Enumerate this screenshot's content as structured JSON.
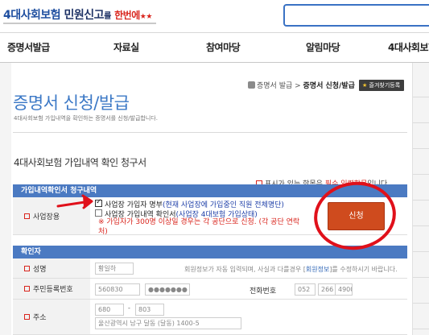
{
  "header": {
    "logo": {
      "part1": "4대사회보험",
      "part2": "민원신고",
      "part3": "를",
      "part4": "한번에",
      "star": "★★"
    },
    "search_placeholder": ""
  },
  "nav": {
    "items": [
      "증명서발급",
      "자료실",
      "참여마당",
      "알림마당",
      "4대사회보험"
    ]
  },
  "breadcrumb": {
    "home": "증명서 발급",
    "sep": " > ",
    "current": "증명서 신청/발급"
  },
  "favorites_button": "즐겨찾기등록",
  "page": {
    "title": "증명서 신청/발급",
    "description": "4대사회보험 가입내역을 확인하는 증명서를 신청/발급합니다."
  },
  "form": {
    "title": "4대사회보험 가입내역 확인 청구서",
    "notice": {
      "pre": "표시가 있는 항목은 ",
      "req": "필수 입력항목",
      "post": "입니다."
    },
    "section1_title": "가입내역확인서 청구내역",
    "workplace_label": "사업장용",
    "option1": {
      "pre": "사업장 가입자 명부",
      "detail": "(현재 사업장에 가입중인 직원 전체명단)",
      "checked": true
    },
    "option2": {
      "pre": "사업장 가입내역 확인서",
      "detail": "(사업장 4대보험 가입상태)",
      "checked": false
    },
    "warning_line1": "※ 가입자가 300명 이상일 경우는 각 공단으로 신청. (각 공단 연락",
    "warning_line2": "처)",
    "apply_button": "신청",
    "section2_title": "확인자",
    "name_label": "성명",
    "name_value": "황일하",
    "name_help": {
      "pre": "회원정보가 자동 입력되며, 사실과 다를경우 [",
      "link": "회원정보",
      "post": "]를 수정하시기 바랍니다."
    },
    "rrn_label": "주민등록번호",
    "rrn_front": "560830",
    "rrn_back": "●●●●●●●",
    "phone_label": "전화번호",
    "phone": [
      "052",
      "266",
      "4900"
    ],
    "address_label": "주소",
    "zip1": "680",
    "zip_sep": "-",
    "zip2": "803",
    "address_value": "울산광역시 남구 달동 (달동)  1400-5"
  },
  "annotations": {
    "color": "#e0101a"
  },
  "colors": {
    "accent": "#3b78c6",
    "bar": "#4b7ac2",
    "button": "#cf4b1e",
    "required": "#d9251d"
  }
}
